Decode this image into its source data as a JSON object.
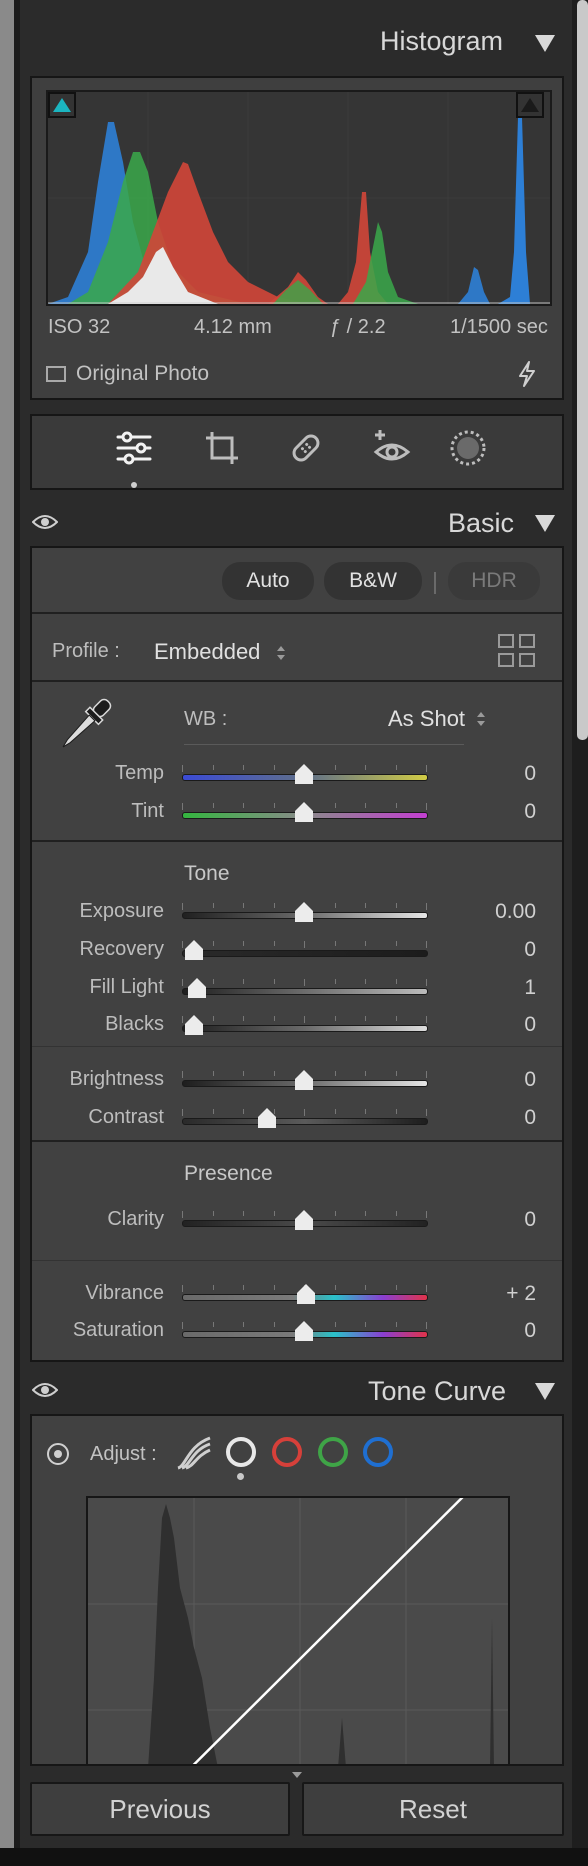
{
  "histogram": {
    "title": "Histogram",
    "iso": "ISO 32",
    "focal": "4.12 mm",
    "aperture": "ƒ / 2.2",
    "shutter": "1/1500 sec",
    "original_photo": "Original Photo"
  },
  "tools": [
    "sliders-icon",
    "crop-icon",
    "healing-icon",
    "redeye-icon",
    "mask-icon"
  ],
  "basic": {
    "title": "Basic",
    "auto": "Auto",
    "bw": "B&W",
    "hdr": "HDR",
    "profile_label": "Profile :",
    "profile_value": "Embedded",
    "wb_label": "WB :",
    "wb_value": "As Shot",
    "temp": {
      "label": "Temp",
      "value": "0"
    },
    "tint": {
      "label": "Tint",
      "value": "0"
    },
    "tone_heading": "Tone",
    "exposure": {
      "label": "Exposure",
      "value": "0.00"
    },
    "recovery": {
      "label": "Recovery",
      "value": "0"
    },
    "fill_light": {
      "label": "Fill Light",
      "value": "1"
    },
    "blacks": {
      "label": "Blacks",
      "value": "0"
    },
    "brightness": {
      "label": "Brightness",
      "value": "0"
    },
    "contrast": {
      "label": "Contrast",
      "value": "0"
    },
    "presence_heading": "Presence",
    "clarity": {
      "label": "Clarity",
      "value": "0"
    },
    "vibrance": {
      "label": "Vibrance",
      "value": "+ 2"
    },
    "saturation": {
      "label": "Saturation",
      "value": "0"
    }
  },
  "tone_curve": {
    "title": "Tone Curve",
    "adjust_label": "Adjust :"
  },
  "footer": {
    "previous": "Previous",
    "reset": "Reset"
  },
  "colors": {
    "accent_cyan": "#1bb5c0",
    "red": "#d6403a",
    "green": "#3fa447",
    "blue": "#1f6fd1"
  }
}
